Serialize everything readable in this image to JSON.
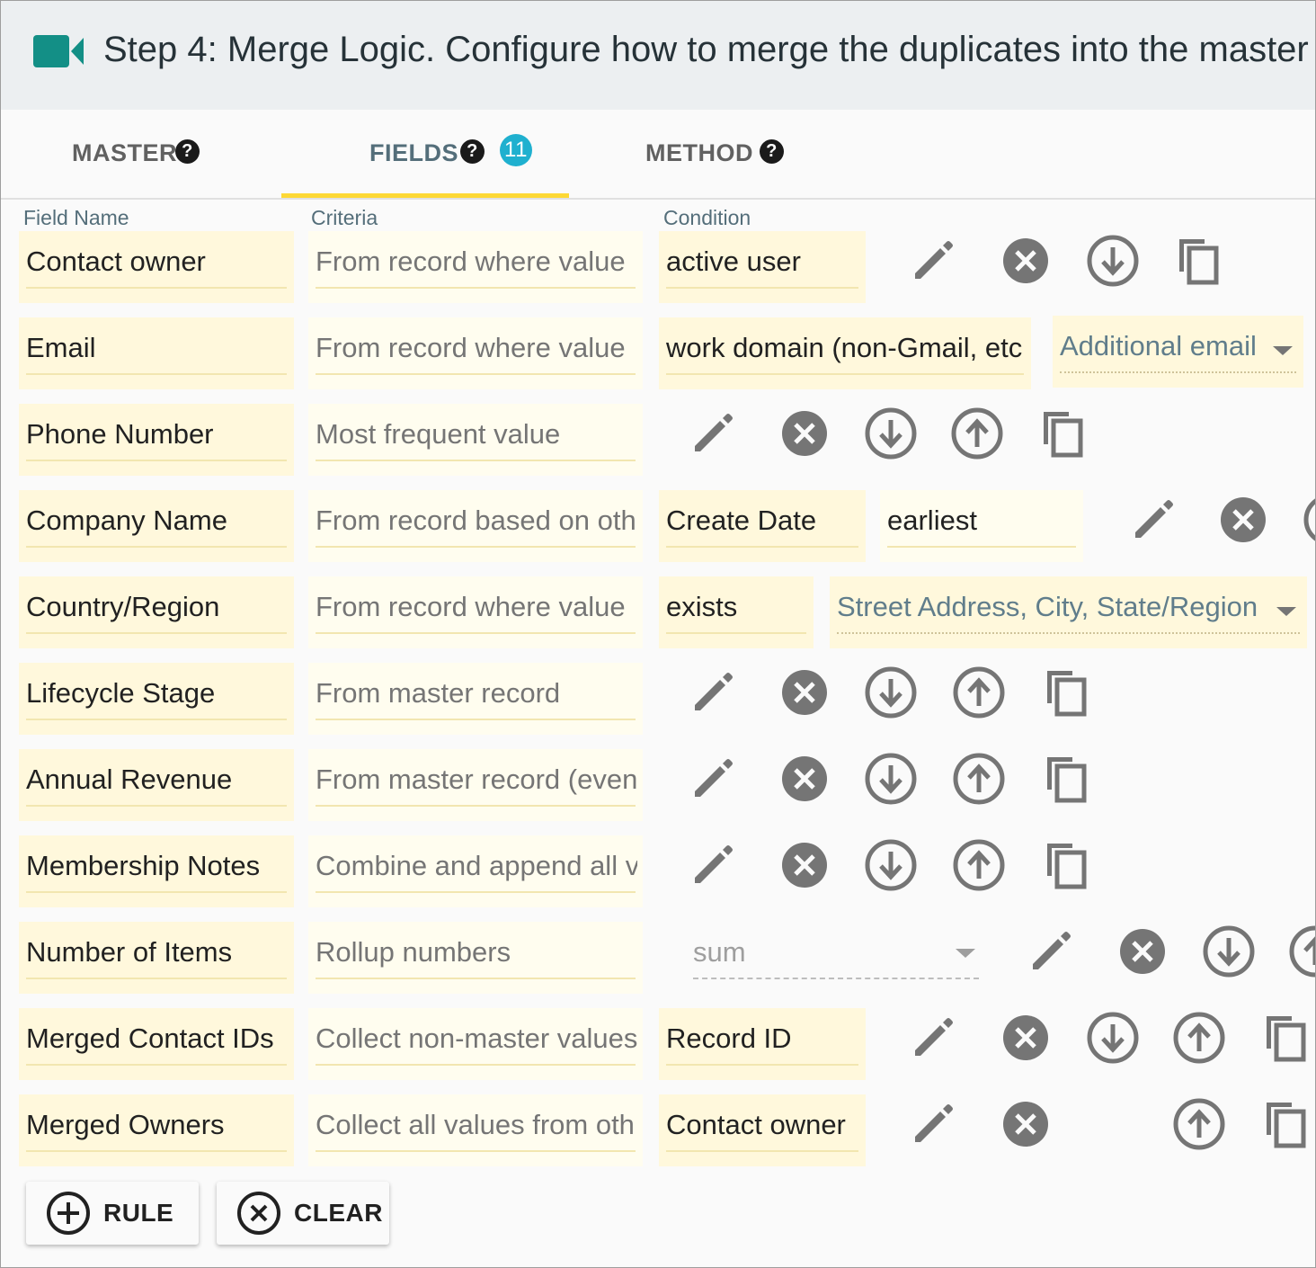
{
  "header": {
    "title": "Step 4: Merge Logic. Configure how to merge the duplicates into the master",
    "icon": "video-camera-icon",
    "icon_color": "#138f86"
  },
  "tabs": [
    {
      "label": "MASTER",
      "active": false
    },
    {
      "label": "FIELDS",
      "active": true,
      "badge": "11"
    },
    {
      "label": "METHOD",
      "active": false
    }
  ],
  "columns": {
    "field_name": "Field Name",
    "criteria": "Criteria",
    "condition": "Condition"
  },
  "rows": [
    {
      "field": "Contact owner",
      "criteria": "From record where value",
      "condition": "active user"
    },
    {
      "field": "Email",
      "criteria": "From record where value",
      "condition": "work domain (non-Gmail, etc",
      "option": "Additional email"
    },
    {
      "field": "Phone Number",
      "criteria": "Most frequent value"
    },
    {
      "field": "Company Name",
      "criteria": "From record based on oth",
      "condition": "Create Date",
      "condition2": "earliest"
    },
    {
      "field": "Country/Region",
      "criteria": "From record where value",
      "condition": "exists",
      "option": "Street Address, City, State/Region"
    },
    {
      "field": "Lifecycle Stage",
      "criteria": "From master record"
    },
    {
      "field": "Annual Revenue",
      "criteria": "From master record (even"
    },
    {
      "field": "Membership Notes",
      "criteria": "Combine and append all v"
    },
    {
      "field": "Number of Items",
      "criteria": "Rollup numbers",
      "option": "sum"
    },
    {
      "field": "Merged Contact IDs",
      "criteria": "Collect non-master values",
      "condition": "Record ID"
    },
    {
      "field": "Merged Owners",
      "criteria": "Collect all values from oth",
      "condition": "Contact owner"
    }
  ],
  "buttons": {
    "rule": "RULE",
    "clear": "CLEAR"
  },
  "colors": {
    "cell_bg": "#fff8dc",
    "accent": "#fdd835",
    "badge": "#1fb0cf",
    "icon": "#757575"
  }
}
